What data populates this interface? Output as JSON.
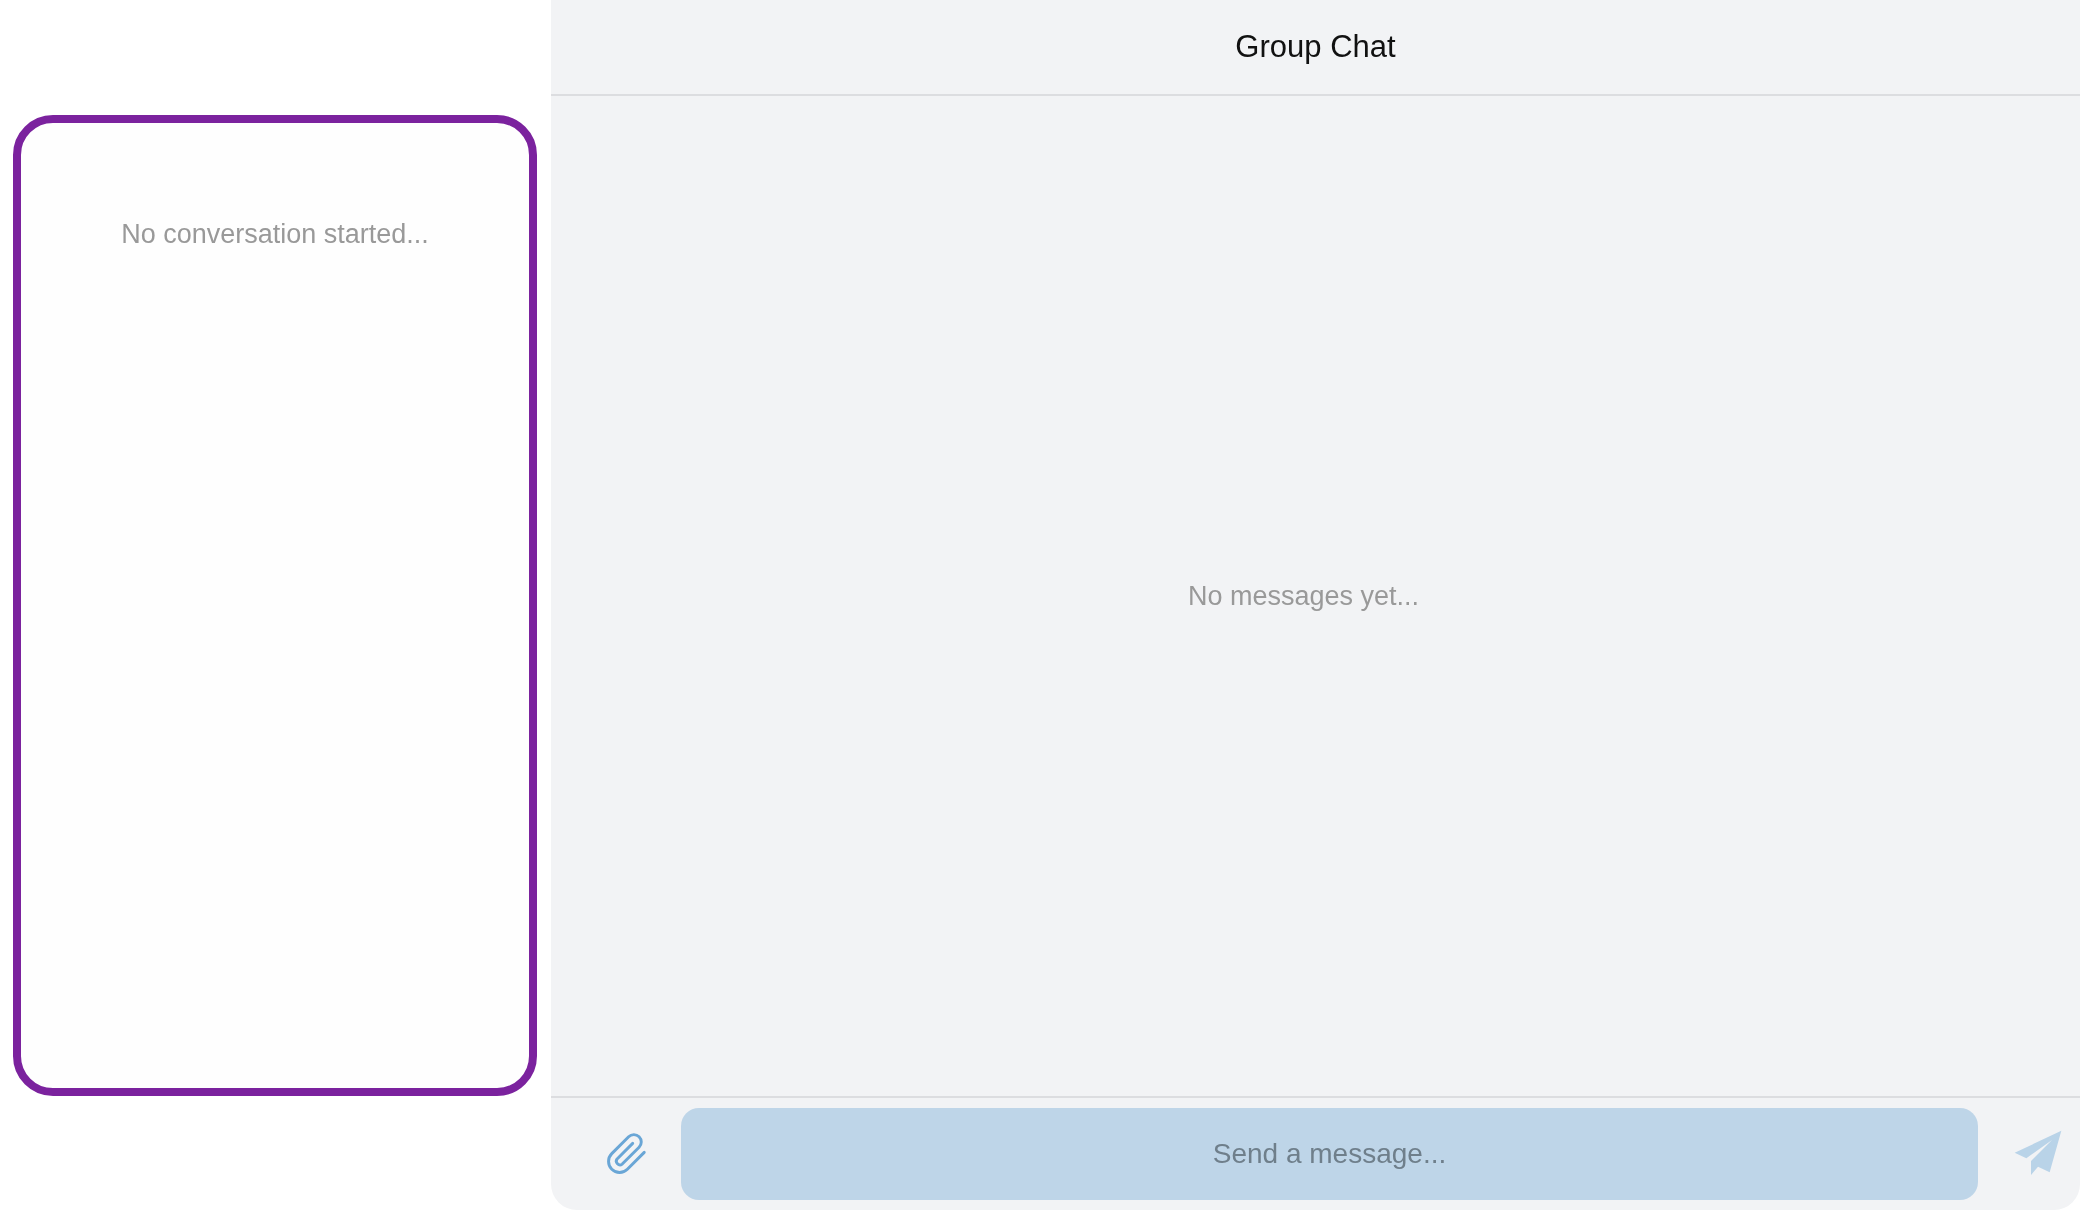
{
  "sidebar": {
    "empty_text": "No conversation started..."
  },
  "chat": {
    "title": "Group Chat",
    "empty_text": "No messages yet...",
    "composer": {
      "placeholder": "Send a message..."
    }
  }
}
